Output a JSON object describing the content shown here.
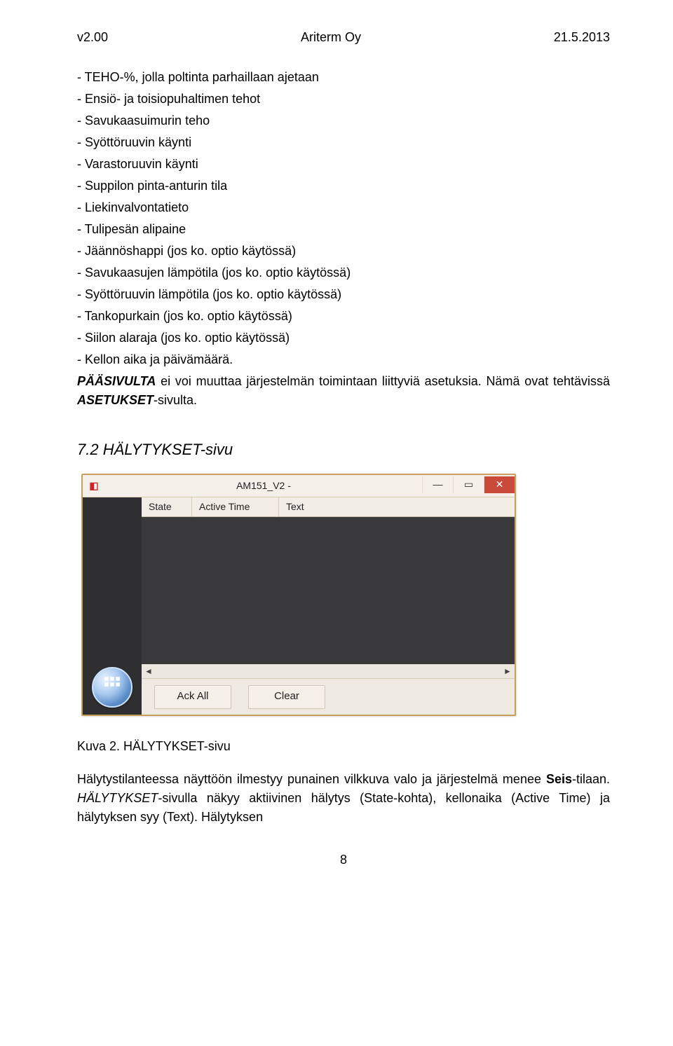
{
  "header": {
    "left": "v2.00",
    "center": "Ariterm Oy",
    "right": "21.5.2013"
  },
  "list": [
    "- TEHO-%, jolla poltinta parhaillaan ajetaan",
    "- Ensiö- ja toisiopuhaltimen tehot",
    "- Savukaasuimurin teho",
    "- Syöttöruuvin käynti",
    "- Varastoruuvin käynti",
    "- Suppilon pinta-anturin tila",
    "- Liekinvalvontatieto",
    "- Tulipesän alipaine",
    "- Jäännöshappi (jos ko. optio käytössä)",
    "- Savukaasujen lämpötila (jos ko. optio käytössä)",
    "- Syöttöruuvin lämpötila (jos ko. optio käytössä)",
    "- Tankopurkain (jos ko. optio käytössä)",
    "- Siilon alaraja (jos ko. optio käytössä)",
    "- Kellon aika ja päivämäärä."
  ],
  "para1_a": "PÄÄSIVULTA",
  "para1_b": " ei voi muuttaa järjestelmän toimintaan liittyviä asetuksia. Nämä ovat tehtävissä ",
  "para1_c": "ASETUKSET",
  "para1_d": "-sivulta.",
  "heading": "7.2 HÄLYTYKSET-sivu",
  "app": {
    "title": "AM151_V2 -",
    "columns": {
      "state": "State",
      "time": "Active Time",
      "text": "Text"
    },
    "buttons": {
      "ack": "Ack All",
      "clear": "Clear"
    }
  },
  "caption": "Kuva 2. HÄLYTYKSET-sivu",
  "para2_a": "Hälytystilanteessa näyttöön ilmestyy punainen vilkkuva valo ja järjestelmä menee ",
  "para2_b": "Seis",
  "para2_c": "-tilaan. ",
  "para2_d": "HÄLYTYKSET",
  "para2_e": "-sivulla näkyy aktiivinen hälytys (State-kohta), kellonaika (Active Time) ja hälytyksen syy (Text). Hälytyksen",
  "footer": "8"
}
